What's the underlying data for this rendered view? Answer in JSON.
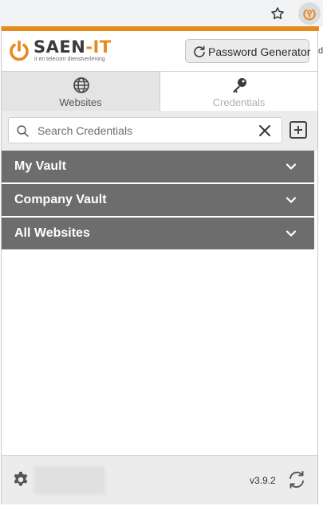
{
  "browser": {
    "star_icon": "star-outline-icon",
    "extension_icon": "power-key-icon",
    "edge_glyph": "d"
  },
  "brand": {
    "logo_main": "SAEN",
    "logo_dash": "-",
    "logo_it": "IT",
    "tagline": "it en telecom dienstverlening",
    "accent_color": "#e8891d"
  },
  "header": {
    "password_generator_label": "Password Generator",
    "password_generator_icon": "refresh-icon"
  },
  "tabs": [
    {
      "label": "Websites",
      "icon": "globe-icon",
      "active": true
    },
    {
      "label": "Credentials",
      "icon": "key-icon",
      "active": false
    }
  ],
  "search": {
    "placeholder": "Search Credentials",
    "value": ""
  },
  "vaults": [
    {
      "label": "My Vault"
    },
    {
      "label": "Company Vault"
    },
    {
      "label": "All Websites"
    }
  ],
  "footer": {
    "version": "v3.9.2"
  },
  "colors": {
    "vault_row": "#6d6d6d",
    "active_tab": "#e4e4e4"
  }
}
